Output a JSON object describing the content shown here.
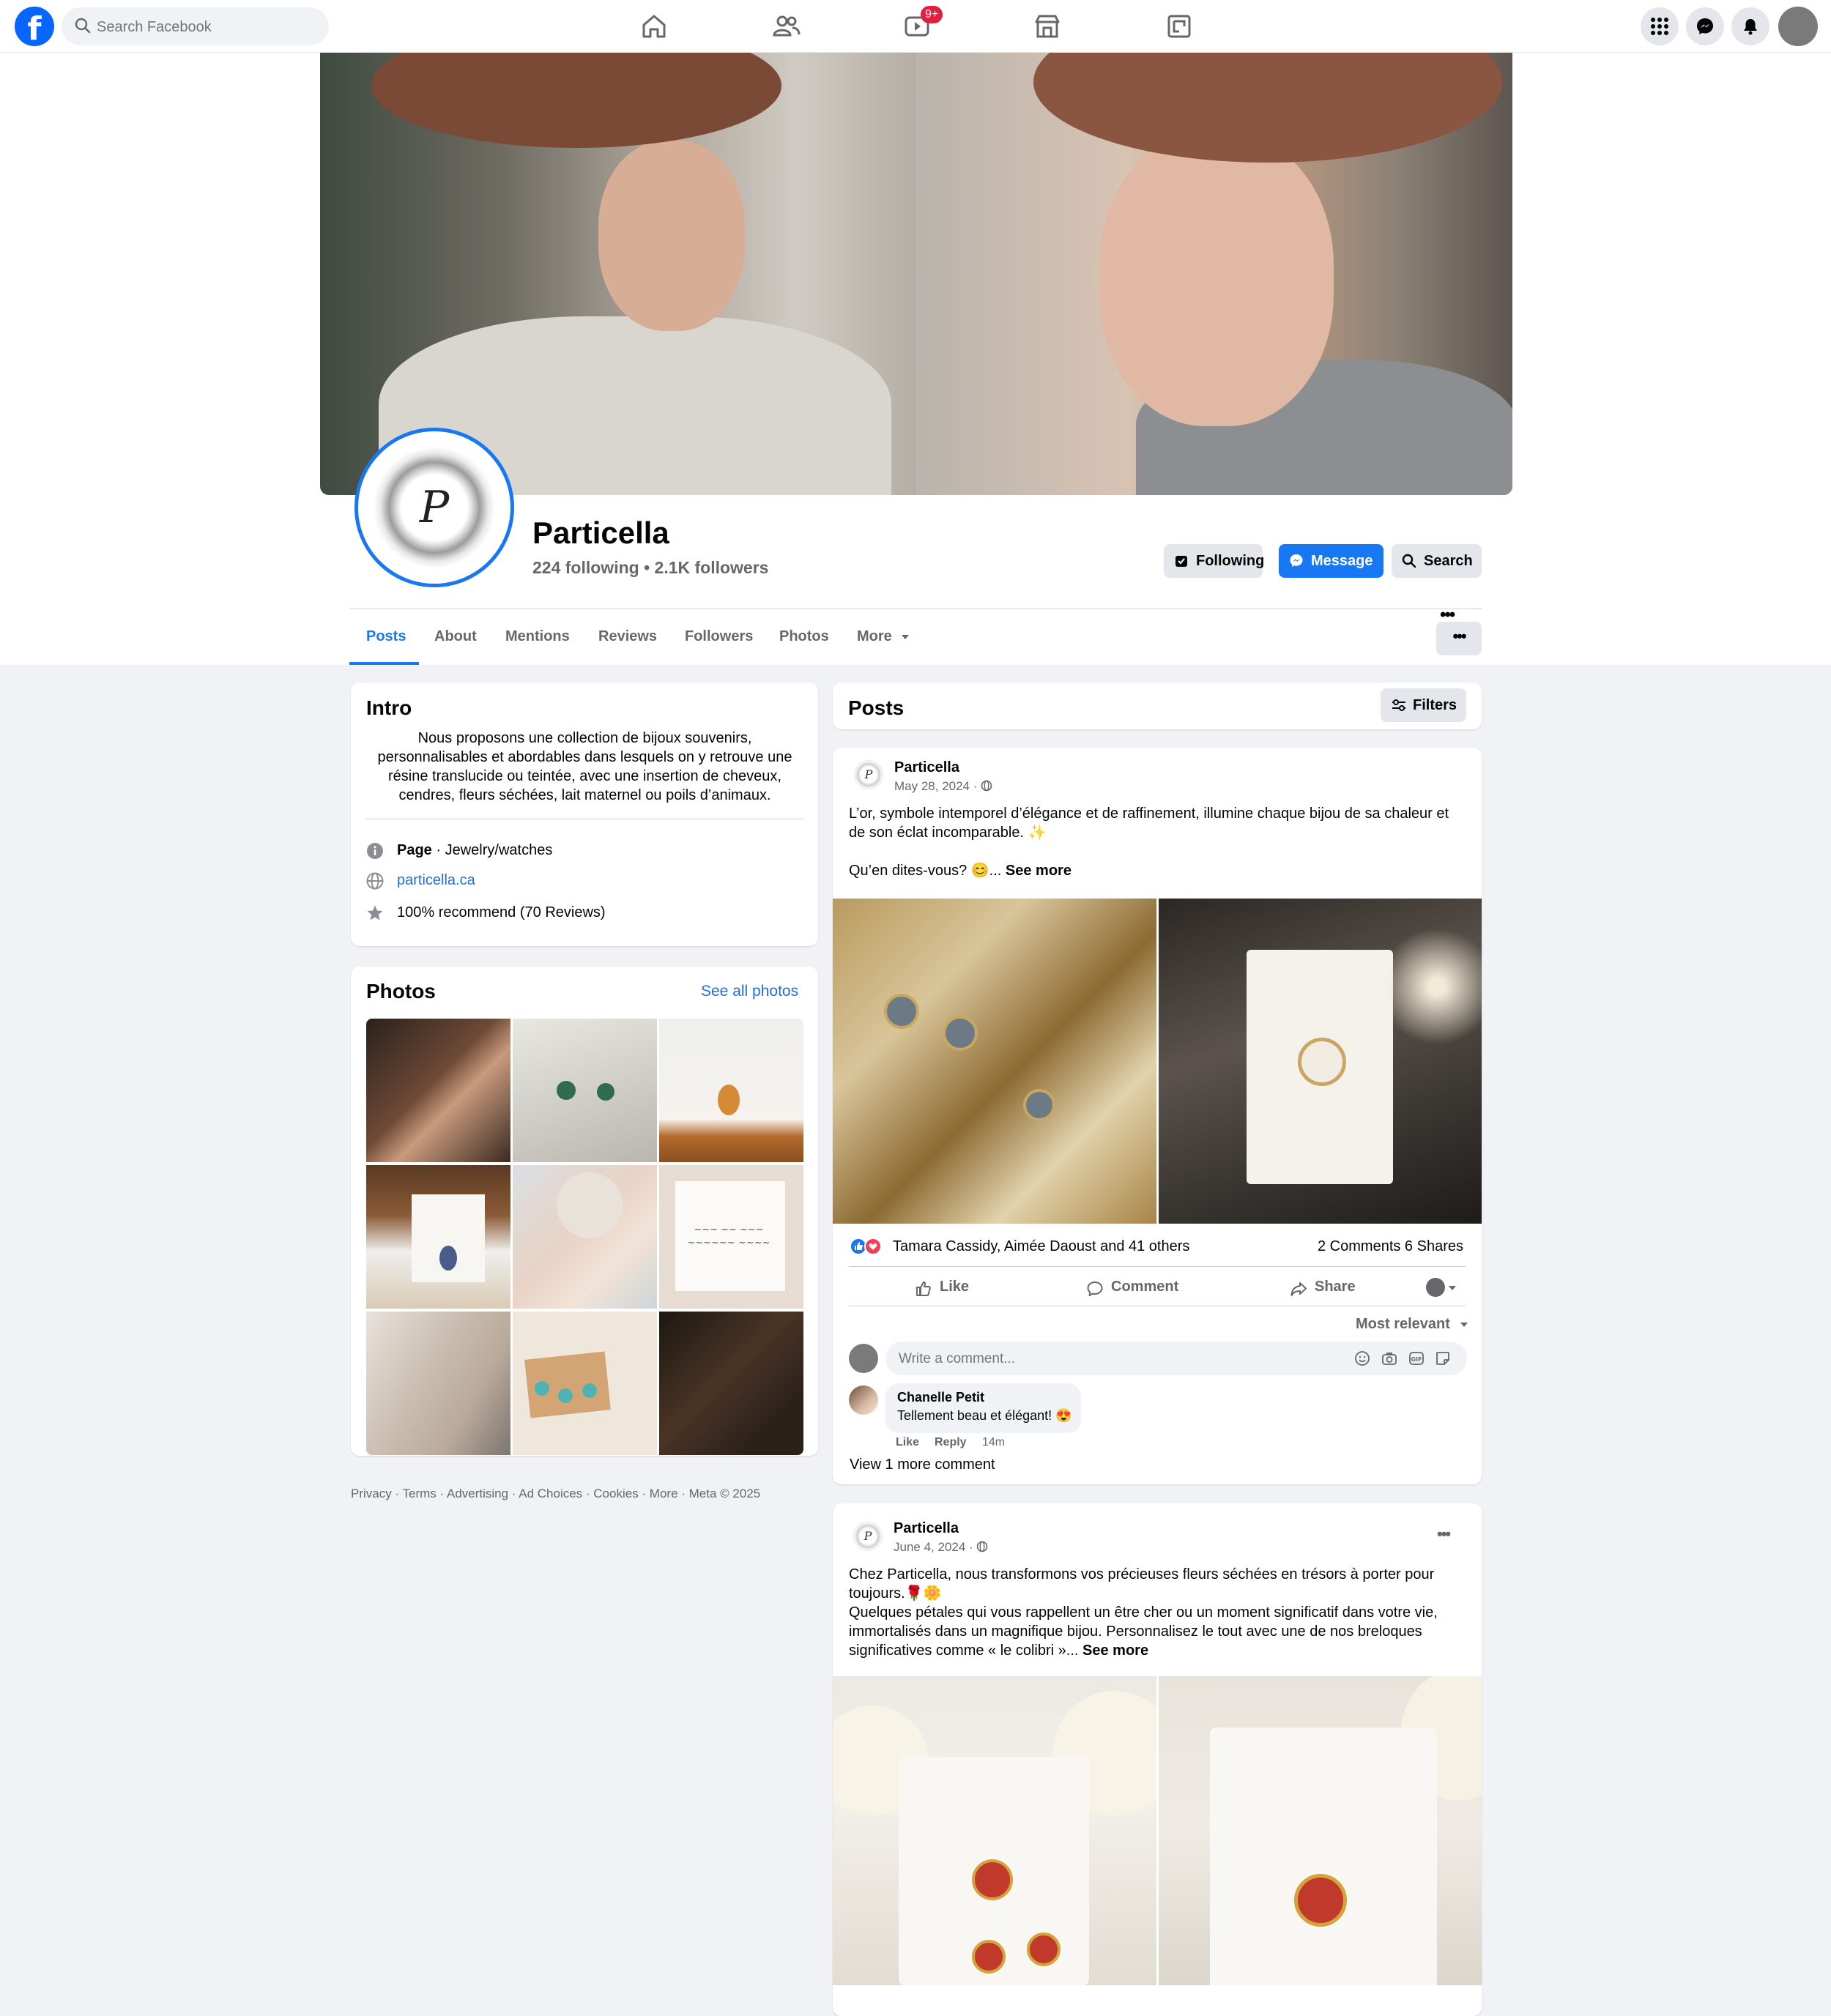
{
  "topbar": {
    "search_placeholder": "Search Facebook",
    "video_badge": "9+"
  },
  "page": {
    "name": "Particella",
    "following": "224 following",
    "followers": "2.1K followers",
    "buttons": {
      "following": "Following",
      "message": "Message",
      "search": "Search"
    },
    "tabs": [
      "Posts",
      "About",
      "Mentions",
      "Reviews",
      "Followers",
      "Photos",
      "More"
    ],
    "active_tab": "Posts",
    "more_dots": "•••"
  },
  "intro": {
    "title": "Intro",
    "description": "Nous proposons une collection de bijoux souvenirs, personnalisables et abordables dans lesquels on y retrouve une résine translucide ou teintée, avec une insertion de cheveux, cendres, fleurs séchées, lait maternel ou poils d’animaux.",
    "category_label": "Page",
    "category": "Jewelry/watches",
    "website": "particella.ca",
    "recommend": "100% recommend (70 Reviews)"
  },
  "photos_card": {
    "title": "Photos",
    "see_all": "See all photos"
  },
  "footer": "Privacy · Terms · Advertising · Ad Choices · Cookies · More · Meta © 2025",
  "posts_header": {
    "title": "Posts",
    "filters": "Filters"
  },
  "post1": {
    "author": "Particella",
    "date": "May 28, 2024 ·",
    "text_line1": "L’or, symbole intemporel d’élégance et de raffinement, illumine chaque bijou de sa chaleur et de son éclat incomparable. ✨",
    "text_line2": "Qu’en dites-vous? 😊...",
    "see_more": "See more",
    "reactions": "Tamara Cassidy, Aimée Daoust and 41 others",
    "counts": "2 Comments 6 Shares",
    "like": "Like",
    "comment": "Comment",
    "share": "Share",
    "sort": "Most relevant",
    "comment_placeholder": "Write a comment...",
    "commenter": "Chanelle Petit",
    "comment_text": "Tellement beau et élégant! 😍",
    "comment_like": "Like",
    "comment_reply": "Reply",
    "comment_time": "14m",
    "view_more": "View 1 more comment"
  },
  "post2": {
    "author": "Particella",
    "date": "June 4, 2024 ·",
    "text": "Chez Particella, nous transformons vos précieuses fleurs séchées en trésors à porter pour toujours.🌹🌼\nQuelques pétales qui vous rappellent un être cher ou un moment significatif dans votre vie, immortalisés dans un magnifique bijou. Personnalisez le tout avec une de nos breloques significatives comme « le colibri »...",
    "see_more": "See more",
    "more_dots": "•••"
  },
  "colors": {
    "brand_blue": "#1877f2",
    "link_blue": "#216fdb",
    "background": "#f0f2f5",
    "badge_red": "#e41e3f"
  }
}
